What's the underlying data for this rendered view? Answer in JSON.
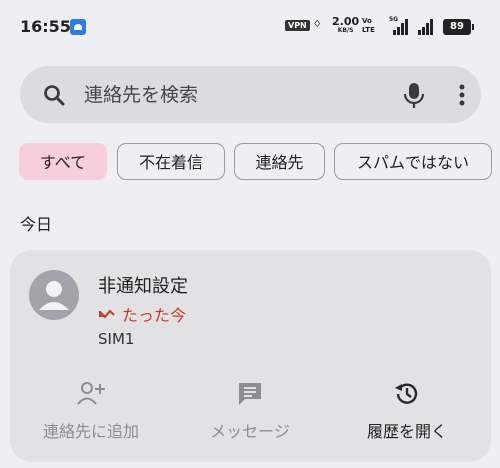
{
  "status_bar": {
    "time": "16:55",
    "vpn": "VPN",
    "speed_value": "2.00",
    "speed_unit": "KB/S",
    "volte_top": "Vo",
    "volte_bottom": "LTE",
    "network_type": "5G",
    "battery": "89"
  },
  "search": {
    "placeholder": "連絡先を検索"
  },
  "filters": [
    {
      "label": "すべて",
      "selected": true
    },
    {
      "label": "不在着信",
      "selected": false
    },
    {
      "label": "連絡先",
      "selected": false
    },
    {
      "label": "スパムではない",
      "selected": false
    }
  ],
  "section_header": "今日",
  "call_entry": {
    "name": "非通知設定",
    "type_text": "たった今",
    "type_color": "#c43c2b",
    "sim": "SIM1",
    "actions": {
      "add_contact": "連絡先に追加",
      "message": "メッセージ",
      "history": "履歴を開く"
    }
  },
  "colors": {
    "background": "#efeef3",
    "selected_chip": "#f7cedb",
    "card": "#e2e2e5",
    "missed": "#c43c2b"
  }
}
